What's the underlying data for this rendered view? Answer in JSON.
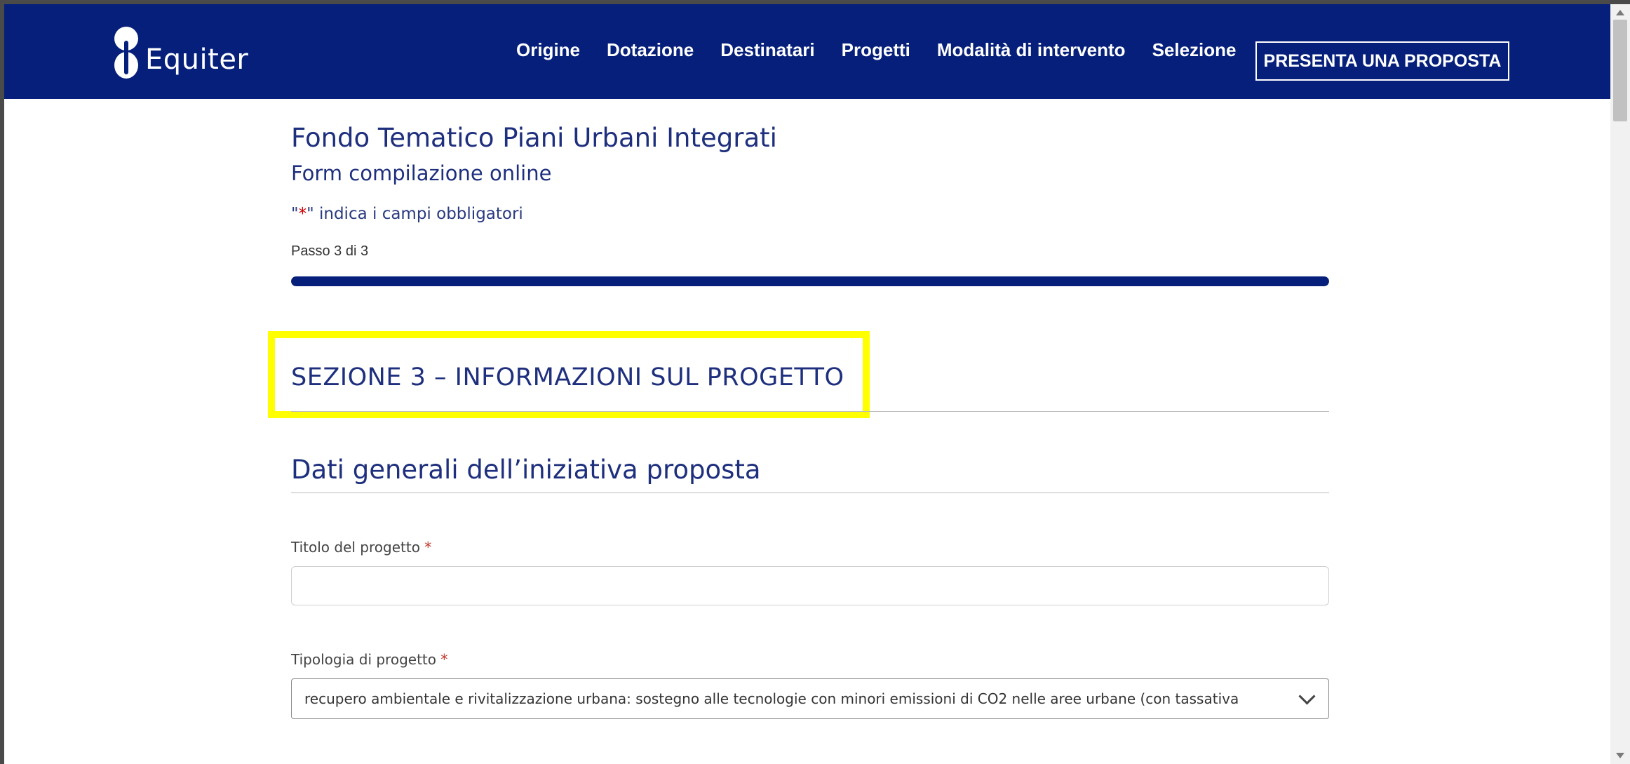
{
  "header": {
    "brand": "Equiter",
    "nav": [
      "Origine",
      "Dotazione",
      "Destinatari",
      "Progetti",
      "Modalità di intervento",
      "Selezione"
    ],
    "cta": "PRESENTA UNA PROPOSTA",
    "background_color": "#051f7a"
  },
  "form": {
    "title": "Fondo Tematico Piani Urbani Integrati",
    "subtitle": "Form compilazione online",
    "required_note_prefix": "\"",
    "required_star": "*",
    "required_note_suffix": "\" indica i campi obbligatori",
    "step_text": "Passo 3 di 3",
    "progress_fraction": 1.0,
    "section_title": "SEZIONE 3 – INFORMAZIONI SUL PROGETTO",
    "section_subtitle": "Dati generali dell’iniziativa proposta",
    "fields": [
      {
        "label": "Titolo del progetto",
        "required_mark": "*",
        "value": ""
      },
      {
        "label": "Tipologia di progetto",
        "required_mark": "*",
        "value": "recupero ambientale e rivitalizzazione urbana: sostegno alle tecnologie con minori emissioni di CO2 nelle aree urbane (con tassativa"
      }
    ]
  },
  "highlight_color": "#ffff00"
}
